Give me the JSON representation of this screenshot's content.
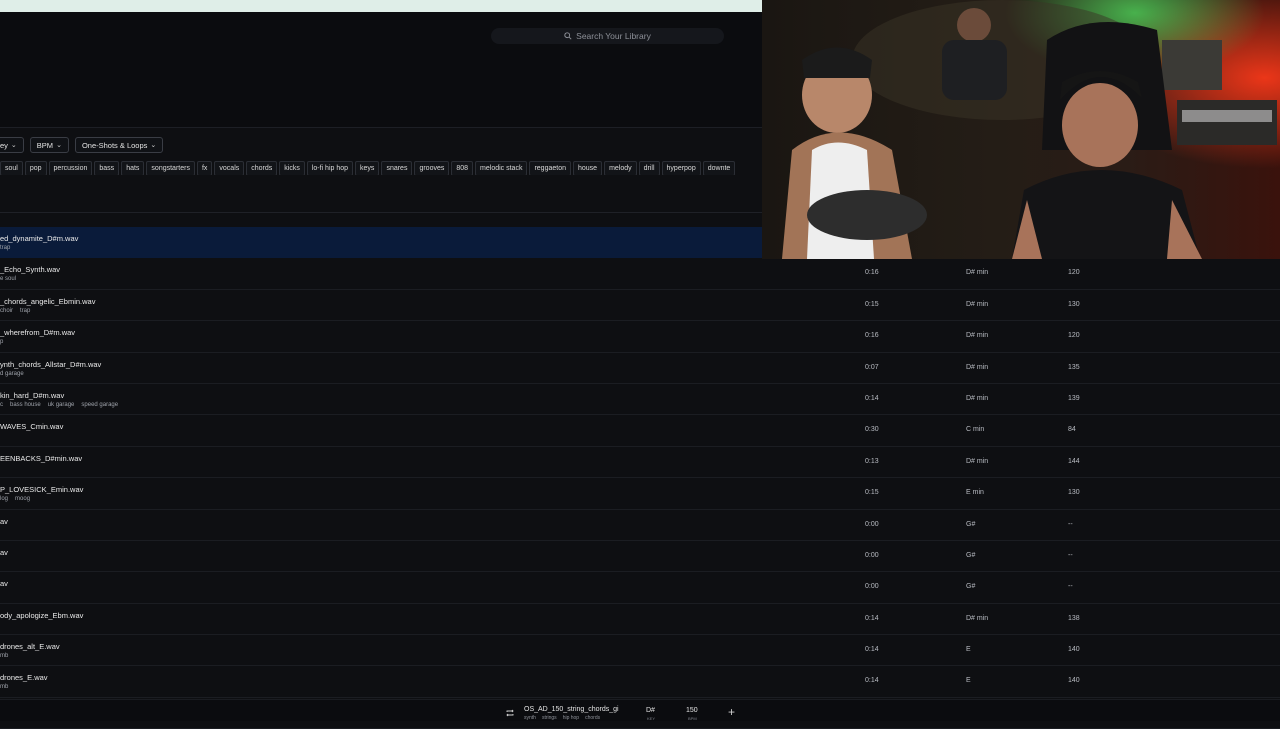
{
  "search": {
    "placeholder": "Search Your Library",
    "icon": "search-icon"
  },
  "filters": [
    {
      "label": "ey"
    },
    {
      "label": "BPM"
    },
    {
      "label": "One-Shots & Loops"
    }
  ],
  "tags": [
    "soul",
    "pop",
    "percussion",
    "bass",
    "hats",
    "songstarters",
    "fx",
    "vocals",
    "chords",
    "kicks",
    "lo-fi hip hop",
    "keys",
    "snares",
    "grooves",
    "808",
    "melodic stack",
    "reggaeton",
    "house",
    "melody",
    "drill",
    "hyperpop",
    "downte"
  ],
  "rows": [
    {
      "name": "ed_dynamite_D#m.wav",
      "tags": [
        "trap"
      ],
      "duration": "",
      "key": "",
      "bpm": "",
      "selected": true
    },
    {
      "name": "_Echo_Synth.wav",
      "tags": [
        "e soul"
      ],
      "duration": "0:16",
      "key": "D# min",
      "bpm": "120"
    },
    {
      "name": "_chords_angelic_Ebmin.wav",
      "tags": [
        "choir",
        "trap"
      ],
      "duration": "0:15",
      "key": "D# min",
      "bpm": "130"
    },
    {
      "name": "_wherefrom_D#m.wav",
      "tags": [
        "p"
      ],
      "duration": "0:16",
      "key": "D# min",
      "bpm": "120"
    },
    {
      "name": "ynth_chords_Allstar_D#m.wav",
      "tags": [
        "d garage"
      ],
      "duration": "0:07",
      "key": "D# min",
      "bpm": "135"
    },
    {
      "name": "kin_hard_D#m.wav",
      "tags": [
        "c",
        "bass house",
        "uk garage",
        "speed garage"
      ],
      "duration": "0:14",
      "key": "D# min",
      "bpm": "139"
    },
    {
      "name": "WAVES_Cmin.wav",
      "tags": [],
      "duration": "0:30",
      "key": "C min",
      "bpm": "84"
    },
    {
      "name": "EENBACKS_D#min.wav",
      "tags": [],
      "duration": "0:13",
      "key": "D# min",
      "bpm": "144"
    },
    {
      "name": "P_LOVESICK_Emin.wav",
      "tags": [
        "log",
        "moog"
      ],
      "duration": "0:15",
      "key": "E min",
      "bpm": "130"
    },
    {
      "name": "av",
      "tags": [],
      "duration": "0:00",
      "key": "G#",
      "bpm": "--"
    },
    {
      "name": "av",
      "tags": [],
      "duration": "0:00",
      "key": "G#",
      "bpm": "--"
    },
    {
      "name": "av",
      "tags": [],
      "duration": "0:00",
      "key": "G#",
      "bpm": "--"
    },
    {
      "name": "ody_apologize_Ebm.wav",
      "tags": [],
      "duration": "0:14",
      "key": "D# min",
      "bpm": "138"
    },
    {
      "name": "drones_alt_E.wav",
      "tags": [
        "mb"
      ],
      "duration": "0:14",
      "key": "E",
      "bpm": "140"
    },
    {
      "name": "drones_E.wav",
      "tags": [
        "mb"
      ],
      "duration": "0:14",
      "key": "E",
      "bpm": "140"
    },
    {
      "name": "_drones_E.wav",
      "tags": [],
      "duration": "0:14",
      "key": "E",
      "bpm": "140"
    }
  ],
  "player": {
    "title": "OS_AD_150_string_chords_gi",
    "tags": [
      "synth",
      "strings",
      "hip hop",
      "chords"
    ],
    "key": "D#",
    "key_label": "KEY",
    "bpm": "150",
    "bpm_label": "BPM",
    "progress": 0.01
  },
  "colors": {
    "selected_row": "#0a1b3a",
    "background": "#0e0f12",
    "accent": "#3a6cff"
  }
}
